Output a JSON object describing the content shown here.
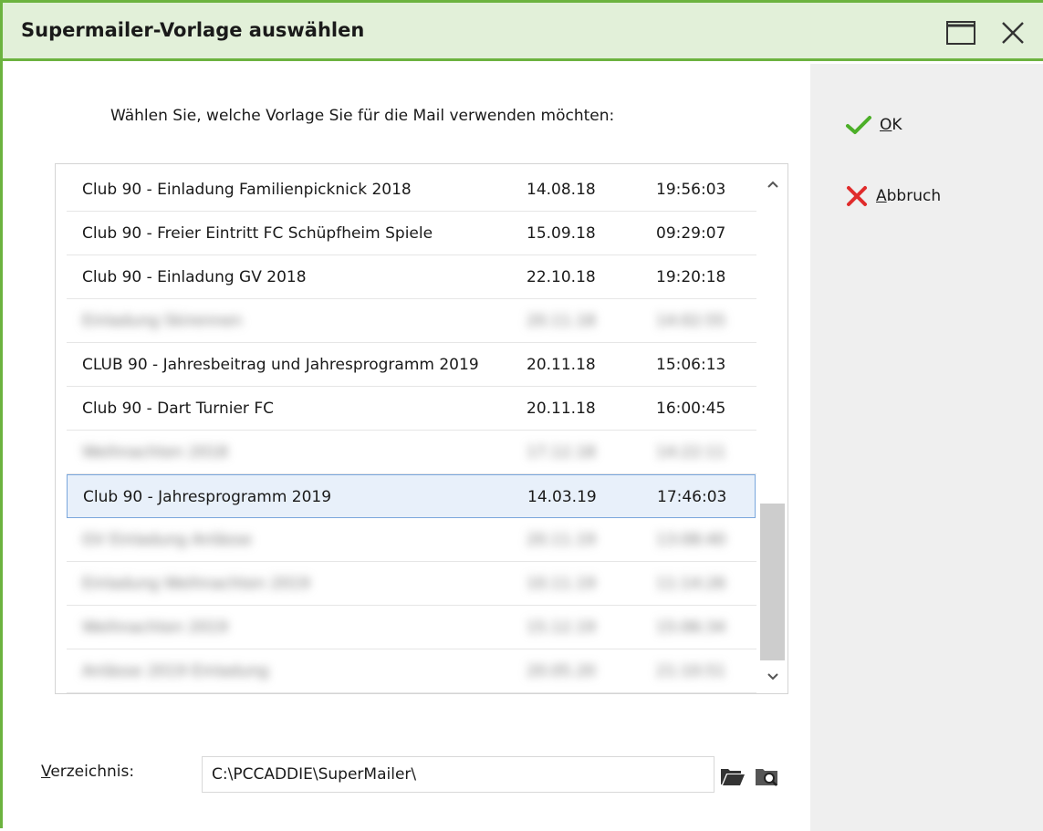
{
  "window": {
    "title": "Supermailer-Vorlage auswählen"
  },
  "instruction": "Wählen Sie, welche Vorlage Sie für die Mail verwenden möchten:",
  "actions": {
    "ok_mnemonic": "O",
    "ok_rest": "K",
    "cancel_mnemonic": "A",
    "cancel_rest": "bbruch"
  },
  "templates": [
    {
      "name": "Club 90 - Einladung Familienpicknick 2018",
      "date": "14.08.18",
      "time": "19:56:03"
    },
    {
      "name": "Club 90 - Freier Eintritt FC Schüpfheim Spiele",
      "date": "15.09.18",
      "time": "09:29:07"
    },
    {
      "name": "Club 90 - Einladung GV 2018",
      "date": "22.10.18",
      "time": "19:20:18"
    },
    {
      "name": "Einladung Skirennen",
      "date": "20.11.18",
      "time": "14:02:55"
    },
    {
      "name": "CLUB 90 - Jahresbeitrag und Jahresprogramm 2019",
      "date": "20.11.18",
      "time": "15:06:13"
    },
    {
      "name": "Club 90 - Dart Turnier FC",
      "date": "20.11.18",
      "time": "16:00:45"
    },
    {
      "name": "Weihnachten 2018",
      "date": "17.12.18",
      "time": "14:22:11"
    },
    {
      "name": "Club 90 - Jahresprogramm 2019",
      "date": "14.03.19",
      "time": "17:46:03"
    },
    {
      "name": "GV Einladung Anlässe",
      "date": "20.11.19",
      "time": "13:08:40"
    },
    {
      "name": "Einladung Weihnachten 2019",
      "date": "10.11.19",
      "time": "11:14:26"
    },
    {
      "name": "Weihnachten 2019",
      "date": "15.12.19",
      "time": "15:06:34"
    },
    {
      "name": "Anlässe 2019 Einladung",
      "date": "20.05.20",
      "time": "21:10:51"
    }
  ],
  "selected_index": 7,
  "blurred_indices": [
    3,
    6,
    8,
    9,
    10,
    11
  ],
  "directory": {
    "label_mnemonic": "V",
    "label_rest": "erzeichnis:",
    "value": "C:\\PCCADDIE\\SuperMailer\\"
  },
  "icons": {
    "maximize": "maximize-icon",
    "close": "close-icon",
    "ok": "checkmark-icon",
    "cancel": "x-mark-icon",
    "scroll_up": "chevron-up-icon",
    "scroll_down": "chevron-down-icon",
    "folder": "folder-open-icon",
    "browse": "folder-search-icon"
  },
  "colors": {
    "accent_green": "#6cb33f",
    "titlebar_bg": "#e2f0d9",
    "ok_green": "#4caf28",
    "cancel_red": "#e02b2b",
    "selection_border": "#7aa7dc"
  }
}
